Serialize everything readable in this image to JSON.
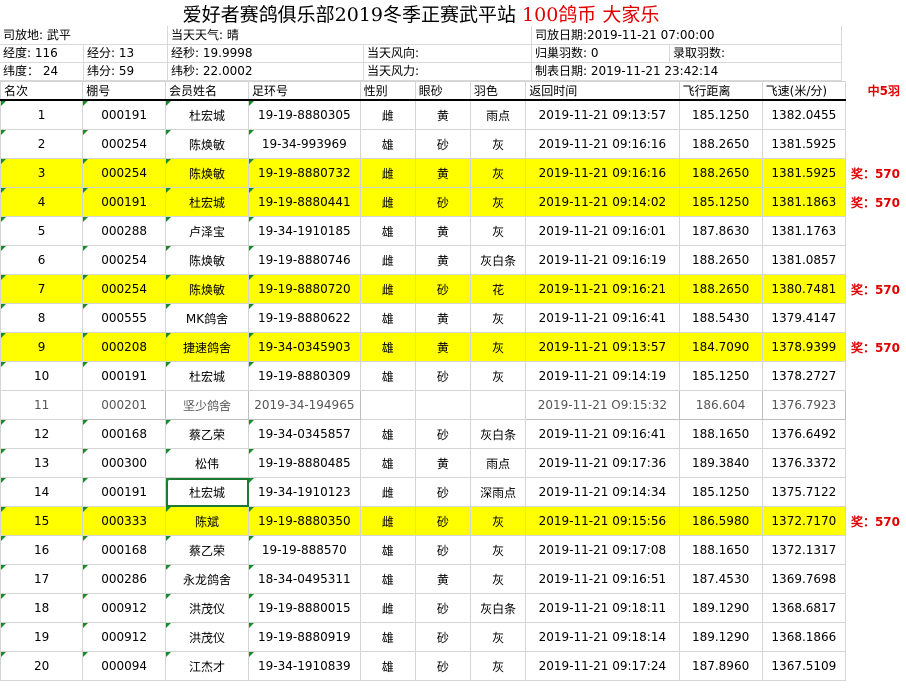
{
  "title": {
    "part1": "爱好者赛鸽俱乐部",
    "part2": "2019",
    "part3": "冬季正赛武平站 ",
    "part4": "100鸽币 大家乐"
  },
  "info": {
    "release_place": "司放地: 武平",
    "weather": "当天天气: 晴",
    "release_date": "司放日期:2019-11-21 07:00:00",
    "lon_deg": "经度: 116",
    "lon_min": "经分: 13",
    "lon_sec": "经秒: 19.9998",
    "wind_dir": "当天风向:",
    "returned": "归巢羽数: 0",
    "recorded": "录取羽数:",
    "lat_deg": "纬度： 24",
    "lat_min": "纬分: 59",
    "lat_sec": "纬秒: 22.0002",
    "wind_force": "当天风力:",
    "made_date": "制表日期: 2019-11-21 23:42:14"
  },
  "headers": [
    "名次",
    "棚号",
    "会员姓名",
    "足环号",
    "性别",
    "眼砂",
    "羽色",
    "返回时间",
    "飞行距离",
    "飞速(米/分)"
  ],
  "prize_header": "中5羽",
  "rows": [
    {
      "rank": "1",
      "loft": "000191",
      "name": "杜宏城",
      "ring": "19-19-8880305",
      "sex": "雌",
      "eye": "黄",
      "color": "雨点",
      "time": "2019-11-21 09:13:57",
      "dist": "185.1250",
      "speed": "1382.0455",
      "prize": "",
      "hl": false
    },
    {
      "rank": "2",
      "loft": "000254",
      "name": "陈焕敏",
      "ring": "19-34-993969",
      "sex": "雄",
      "eye": "砂",
      "color": "灰",
      "time": "2019-11-21 09:16:16",
      "dist": "188.2650",
      "speed": "1381.5925",
      "prize": "",
      "hl": false
    },
    {
      "rank": "3",
      "loft": "000254",
      "name": "陈焕敏",
      "ring": "19-19-8880732",
      "sex": "雌",
      "eye": "黄",
      "color": "灰",
      "time": "2019-11-21 09:16:16",
      "dist": "188.2650",
      "speed": "1381.5925",
      "prize": "奖：570",
      "hl": true
    },
    {
      "rank": "4",
      "loft": "000191",
      "name": "杜宏城",
      "ring": "19-19-8880441",
      "sex": "雌",
      "eye": "砂",
      "color": "灰",
      "time": "2019-11-21 09:14:02",
      "dist": "185.1250",
      "speed": "1381.1863",
      "prize": "奖：570",
      "hl": true
    },
    {
      "rank": "5",
      "loft": "000288",
      "name": "卢泽宝",
      "ring": "19-34-1910185",
      "sex": "雄",
      "eye": "黄",
      "color": "灰",
      "time": "2019-11-21 09:16:01",
      "dist": "187.8630",
      "speed": "1381.1763",
      "prize": "",
      "hl": false
    },
    {
      "rank": "6",
      "loft": "000254",
      "name": "陈焕敏",
      "ring": "19-19-8880746",
      "sex": "雌",
      "eye": "黄",
      "color": "灰白条",
      "time": "2019-11-21 09:16:19",
      "dist": "188.2650",
      "speed": "1381.0857",
      "prize": "",
      "hl": false
    },
    {
      "rank": "7",
      "loft": "000254",
      "name": "陈焕敏",
      "ring": "19-19-8880720",
      "sex": "雌",
      "eye": "砂",
      "color": "花",
      "time": "2019-11-21 09:16:21",
      "dist": "188.2650",
      "speed": "1380.7481",
      "prize": "奖：570",
      "hl": true
    },
    {
      "rank": "8",
      "loft": "000555",
      "name": "MK鸽舍",
      "ring": "19-19-8880622",
      "sex": "雄",
      "eye": "黄",
      "color": "灰",
      "time": "2019-11-21 09:16:41",
      "dist": "188.5430",
      "speed": "1379.4147",
      "prize": "",
      "hl": false
    },
    {
      "rank": "9",
      "loft": "000208",
      "name": "捷速鸽舍",
      "ring": "19-34-0345903",
      "sex": "雄",
      "eye": "黄",
      "color": "灰",
      "time": "2019-11-21 09:13:57",
      "dist": "184.7090",
      "speed": "1378.9399",
      "prize": "奖：570",
      "hl": true
    },
    {
      "rank": "10",
      "loft": "000191",
      "name": "杜宏城",
      "ring": "19-19-8880309",
      "sex": "雄",
      "eye": "砂",
      "color": "灰",
      "time": "2019-11-21 09:14:19",
      "dist": "185.1250",
      "speed": "1378.2727",
      "prize": "",
      "hl": false
    },
    {
      "rank": "11",
      "loft": "000201",
      "name": "坚少鸽舍",
      "ring": "2019-34-194965",
      "sex": "",
      "eye": "",
      "color": "",
      "time": "2019-11-21 O9:15:32",
      "dist": "186.604",
      "speed": "1376.7923",
      "prize": "",
      "hl": false,
      "ghost": true
    },
    {
      "rank": "12",
      "loft": "000168",
      "name": "蔡乙荣",
      "ring": "19-34-0345857",
      "sex": "雄",
      "eye": "砂",
      "color": "灰白条",
      "time": "2019-11-21 09:16:41",
      "dist": "188.1650",
      "speed": "1376.6492",
      "prize": "",
      "hl": false
    },
    {
      "rank": "13",
      "loft": "000300",
      "name": "松伟",
      "ring": "19-19-8880485",
      "sex": "雄",
      "eye": "黄",
      "color": "雨点",
      "time": "2019-11-21 09:17:36",
      "dist": "189.3840",
      "speed": "1376.3372",
      "prize": "",
      "hl": false
    },
    {
      "rank": "14",
      "loft": "000191",
      "name": "杜宏城",
      "ring": "19-34-1910123",
      "sex": "雌",
      "eye": "砂",
      "color": "深雨点",
      "time": "2019-11-21 09:14:34",
      "dist": "185.1250",
      "speed": "1375.7122",
      "prize": "",
      "hl": false,
      "sel": true
    },
    {
      "rank": "15",
      "loft": "000333",
      "name": "陈斌",
      "ring": "19-19-8880350",
      "sex": "雌",
      "eye": "砂",
      "color": "灰",
      "time": "2019-11-21 09:15:56",
      "dist": "186.5980",
      "speed": "1372.7170",
      "prize": "奖：570",
      "hl": true
    },
    {
      "rank": "16",
      "loft": "000168",
      "name": "蔡乙荣",
      "ring": "19-19-888570",
      "sex": "雄",
      "eye": "砂",
      "color": "灰",
      "time": "2019-11-21 09:17:08",
      "dist": "188.1650",
      "speed": "1372.1317",
      "prize": "",
      "hl": false
    },
    {
      "rank": "17",
      "loft": "000286",
      "name": "永龙鸽舍",
      "ring": "18-34-0495311",
      "sex": "雄",
      "eye": "黄",
      "color": "灰",
      "time": "2019-11-21 09:16:51",
      "dist": "187.4530",
      "speed": "1369.7698",
      "prize": "",
      "hl": false
    },
    {
      "rank": "18",
      "loft": "000912",
      "name": "洪茂仪",
      "ring": "19-19-8880015",
      "sex": "雌",
      "eye": "砂",
      "color": "灰白条",
      "time": "2019-11-21 09:18:11",
      "dist": "189.1290",
      "speed": "1368.6817",
      "prize": "",
      "hl": false
    },
    {
      "rank": "19",
      "loft": "000912",
      "name": "洪茂仪",
      "ring": "19-19-8880919",
      "sex": "雄",
      "eye": "砂",
      "color": "灰",
      "time": "2019-11-21 09:18:14",
      "dist": "189.1290",
      "speed": "1368.1866",
      "prize": "",
      "hl": false
    },
    {
      "rank": "20",
      "loft": "000094",
      "name": "江杰才",
      "ring": "19-34-1910839",
      "sex": "雄",
      "eye": "砂",
      "color": "灰",
      "time": "2019-11-21 09:17:24",
      "dist": "187.8960",
      "speed": "1367.5109",
      "prize": "",
      "hl": false
    }
  ]
}
